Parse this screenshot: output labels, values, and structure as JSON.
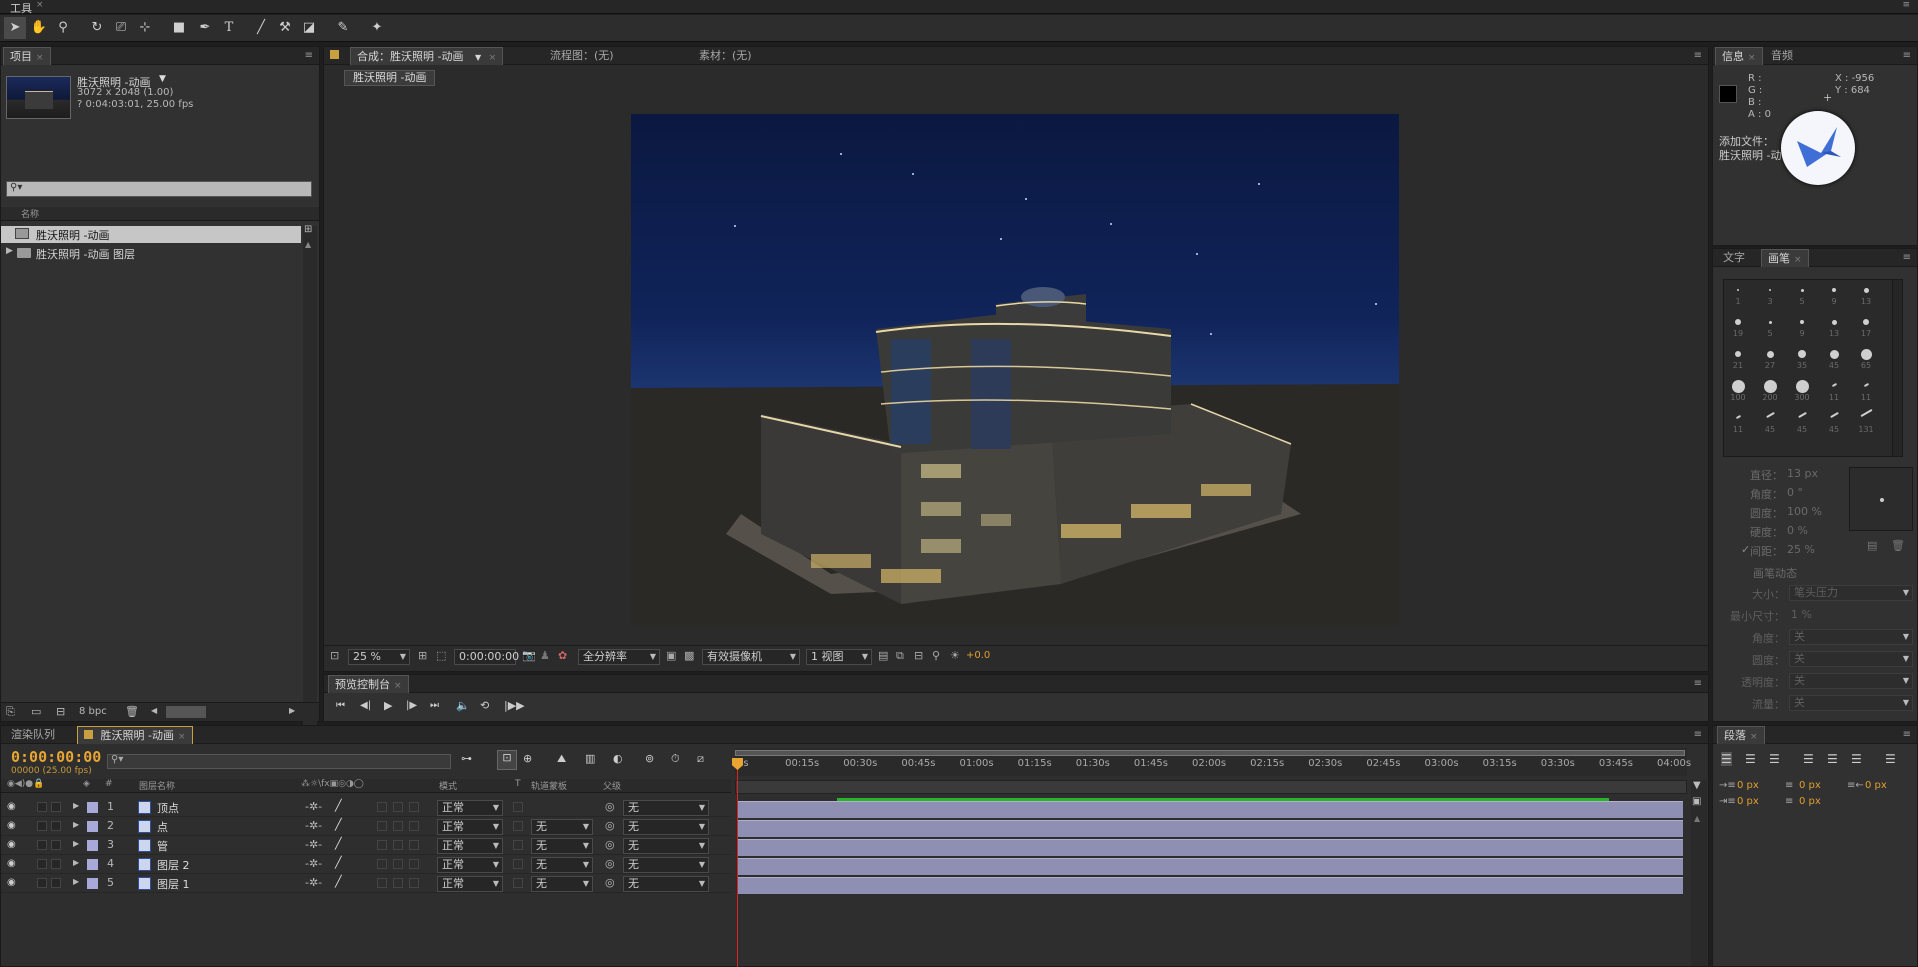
{
  "toolbar": {
    "title": "工具"
  },
  "project": {
    "tab": "项目",
    "comp_name": "胜沃照明 -动画",
    "comp_dims": "3072 x 2048 (1.00)",
    "comp_duration": "? 0:04:03:01, 25.00 fps",
    "column_header": "名称",
    "items": [
      "胜沃照明 -动画",
      "胜沃照明 -动画 图层"
    ],
    "bpc": "8 bpc"
  },
  "comp_viewer": {
    "tab_comp": "合成：胜沃照明 -动画",
    "tab_flow": "流程图：(无)",
    "tab_footage": "素材：(无)",
    "breadcrumb": "胜沃照明 -动画",
    "zoom": "25 %",
    "timecode": "0:00:00:00",
    "resolution": "全分辨率",
    "camera": "有效摄像机",
    "views": "1 视图",
    "exposure": "+0.0"
  },
  "info": {
    "tab_info": "信息",
    "tab_audio": "音频",
    "rgba_labels": [
      "R :",
      "G :",
      "B :",
      "A : 0"
    ],
    "x": "X : -956",
    "y": "Y : 684",
    "line1": "添加文件：",
    "line2": "胜沃照明 -动"
  },
  "brushes": {
    "tab_text": "文字",
    "tab_brush": "画笔",
    "sizes": [
      "1",
      "3",
      "5",
      "9",
      "13",
      "19",
      "5",
      "9",
      "13",
      "17",
      "21",
      "27",
      "35",
      "45",
      "65",
      "100",
      "200",
      "300",
      "11",
      "11",
      "11",
      "45",
      "45",
      "45",
      "131"
    ],
    "props": [
      {
        "label": "直径：",
        "value": "13 px"
      },
      {
        "label": "角度：",
        "value": "0 °"
      },
      {
        "label": "圆度：",
        "value": "100 %"
      },
      {
        "label": "硬度：",
        "value": "0 %"
      },
      {
        "label": "间距：",
        "value": "25 %"
      }
    ],
    "dynamics_title": "画笔动态",
    "dyn": [
      {
        "label": "大小：",
        "value": "笔头压力"
      },
      {
        "label": "最小尺寸：",
        "value": "1 %"
      },
      {
        "label": "角度：",
        "value": "关"
      },
      {
        "label": "圆度：",
        "value": "关"
      },
      {
        "label": "透明度：",
        "value": "关"
      },
      {
        "label": "流量：",
        "value": "关"
      }
    ]
  },
  "preview": {
    "tab": "预览控制台"
  },
  "timeline": {
    "tab_render": "渲染队列",
    "tab_comp": "胜沃照明 -动画",
    "timecode": "0:00:00:00",
    "frames": "00000 (25.00 fps)",
    "col_layer_name": "图层名称",
    "col_mode": "模式",
    "col_t": "T",
    "col_trkmat": "轨道蒙板",
    "col_parent": "父级",
    "ticks": [
      "0s",
      "00:15s",
      "00:30s",
      "00:45s",
      "01:00s",
      "01:15s",
      "01:30s",
      "01:45s",
      "02:00s",
      "02:15s",
      "02:30s",
      "02:45s",
      "03:00s",
      "03:15s",
      "03:30s",
      "03:45s",
      "04:00s"
    ],
    "layers": [
      {
        "num": "1",
        "name": "顶点",
        "mode": "正常",
        "trkmat": "",
        "parent": "无"
      },
      {
        "num": "2",
        "name": "点",
        "mode": "正常",
        "trkmat": "无",
        "parent": "无"
      },
      {
        "num": "3",
        "name": "管",
        "mode": "正常",
        "trkmat": "无",
        "parent": "无"
      },
      {
        "num": "4",
        "name": "图层 2",
        "mode": "正常",
        "trkmat": "无",
        "parent": "无"
      },
      {
        "num": "5",
        "name": "图层 1",
        "mode": "正常",
        "trkmat": "无",
        "parent": "无"
      }
    ]
  },
  "paragraph": {
    "tab": "段落",
    "px": [
      "0 px",
      "0 px",
      "0 px",
      "0 px",
      "0 px"
    ]
  }
}
